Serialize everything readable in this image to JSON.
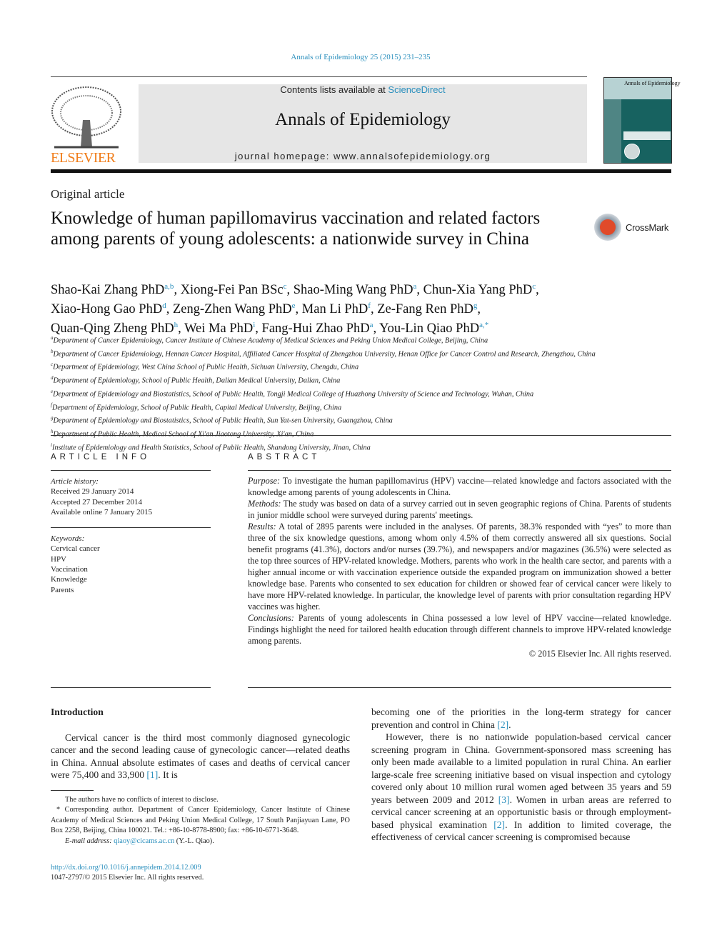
{
  "header": {
    "citation": "Annals of Epidemiology 25 (2015) 231–235",
    "publisher": "ELSEVIER",
    "contents_prefix": "Contents lists available at ",
    "contents_link": "ScienceDirect",
    "journal": "Annals of Epidemiology",
    "homepage": "journal homepage: www.annalsofepidemiology.org",
    "cover_title": "Annals of Epidemiology",
    "colors": {
      "link": "#2a8fbd",
      "publisher": "#f07d1a",
      "cover": "#176260"
    }
  },
  "article_type": "Original article",
  "title": "Knowledge of human papillomavirus vaccination and related factors among parents of young adolescents: a nationwide survey in China",
  "crossmark": "CrossMark",
  "authors": [
    {
      "name": "Shao-Kai Zhang PhD",
      "sup": "a,b"
    },
    {
      "name": "Xiong-Fei Pan BSc",
      "sup": "c"
    },
    {
      "name": "Shao-Ming Wang PhD",
      "sup": "a"
    },
    {
      "name": "Chun-Xia Yang PhD",
      "sup": "c"
    },
    {
      "name": "Xiao-Hong Gao PhD",
      "sup": "d"
    },
    {
      "name": "Zeng-Zhen Wang PhD",
      "sup": "e"
    },
    {
      "name": "Man Li PhD",
      "sup": "f"
    },
    {
      "name": "Ze-Fang Ren PhD",
      "sup": "g"
    },
    {
      "name": "Quan-Qing Zheng PhD",
      "sup": "h"
    },
    {
      "name": "Wei Ma PhD",
      "sup": "i"
    },
    {
      "name": "Fang-Hui Zhao PhD",
      "sup": "a"
    },
    {
      "name": "You-Lin Qiao PhD",
      "sup": "a,*"
    }
  ],
  "affiliations": [
    {
      "key": "a",
      "text": "Department of Cancer Epidemiology, Cancer Institute of Chinese Academy of Medical Sciences and Peking Union Medical College, Beijing, China"
    },
    {
      "key": "b",
      "text": "Department of Cancer Epidemiology, Hennan Cancer Hospital, Affiliated Cancer Hospital of Zhengzhou University, Henan Office for Cancer Control and Research, Zhengzhou, China"
    },
    {
      "key": "c",
      "text": "Department of Epidemiology, West China School of Public Health, Sichuan University, Chengdu, China"
    },
    {
      "key": "d",
      "text": "Department of Epidemiology, School of Public Health, Dalian Medical University, Dalian, China"
    },
    {
      "key": "e",
      "text": "Department of Epidemiology and Biostatistics, School of Public Health, Tongji Medical College of Huazhong University of Science and Technology, Wuhan, China"
    },
    {
      "key": "f",
      "text": "Department of Epidemiology, School of Public Health, Capital Medical University, Beijing, China"
    },
    {
      "key": "g",
      "text": "Department of Epidemiology and Biostatistics, School of Public Health, Sun Yat-sen University, Guangzhou, China"
    },
    {
      "key": "h",
      "text": "Department of Public Health, Medical School of Xi'an Jiaotong University, Xi'an, China"
    },
    {
      "key": "i",
      "text": "Institute of Epidemiology and Health Statistics, School of Public Health, Shandong University, Jinan, China"
    }
  ],
  "article_info": {
    "heading": "ARTICLE INFO",
    "history_label": "Article history:",
    "history": [
      "Received 29 January 2014",
      "Accepted 27 December 2014",
      "Available online 7 January 2015"
    ],
    "keywords_label": "Keywords:",
    "keywords": [
      "Cervical cancer",
      "HPV",
      "Vaccination",
      "Knowledge",
      "Parents"
    ]
  },
  "abstract": {
    "heading": "ABSTRACT",
    "sections": [
      {
        "label": "Purpose:",
        "text": " To investigate the human papillomavirus (HPV) vaccine—related knowledge and factors associated with the knowledge among parents of young adolescents in China."
      },
      {
        "label": "Methods:",
        "text": " The study was based on data of a survey carried out in seven geographic regions of China. Parents of students in junior middle school were surveyed during parents' meetings."
      },
      {
        "label": "Results:",
        "text": " A total of 2895 parents were included in the analyses. Of parents, 38.3% responded with “yes” to more than three of the six knowledge questions, among whom only 4.5% of them correctly answered all six questions. Social benefit programs (41.3%), doctors and/or nurses (39.7%), and newspapers and/or magazines (36.5%) were selected as the top three sources of HPV-related knowledge. Mothers, parents who work in the health care sector, and parents with a higher annual income or with vaccination experience outside the expanded program on immunization showed a better knowledge base. Parents who consented to sex education for children or showed fear of cervical cancer were likely to have more HPV-related knowledge. In particular, the knowledge level of parents with prior consultation regarding HPV vaccines was higher."
      },
      {
        "label": "Conclusions:",
        "text": " Parents of young adolescents in China possessed a low level of HPV vaccine—related knowledge. Findings highlight the need for tailored health education through different channels to improve HPV-related knowledge among parents."
      }
    ],
    "copyright": "© 2015 Elsevier Inc. All rights reserved."
  },
  "body": {
    "intro_heading": "Introduction",
    "col1_p1": [
      "Cervical cancer is the third most commonly diagnosed gynecologic cancer and the second leading cause of gynecologic cancer—related deaths in China. Annual absolute estimates of cases and deaths of cervical cancer were 75,400 and 33,900 ",
      "[1]",
      ". It is"
    ],
    "col2_p1": [
      "becoming one of the priorities in the long-term strategy for cancer prevention and control in China ",
      "[2]",
      "."
    ],
    "col2_p2": [
      "However, there is no nationwide population-based cervical cancer screening program in China. Government-sponsored mass screening has only been made available to a limited population in rural China. An earlier large-scale free screening initiative based on visual inspection and cytology covered only about 10 million rural women aged between 35 years and 59 years between 2009 and 2012 ",
      "[3]",
      ". Women in urban areas are referred to cervical cancer screening at an opportunistic basis or through employment-based physical examination ",
      "[2]",
      ". In addition to limited coverage, the effectiveness of cervical cancer screening is compromised because"
    ]
  },
  "footnotes": {
    "conflict": "The authors have no conflicts of interest to disclose.",
    "corresponding": "* Corresponding author. Department of Cancer Epidemiology, Cancer Institute of Chinese Academy of Medical Sciences and Peking Union Medical College, 17 South Panjiayuan Lane, PO Box 2258, Beijing, China 100021. Tel.: +86-10-8778-8900; fax: +86-10-6771-3648.",
    "email_label": "E-mail address:",
    "email": "qiaoy@cicams.ac.cn",
    "email_suffix": " (Y.-L. Qiao).",
    "doi": "http://dx.doi.org/10.1016/j.annepidem.2014.12.009",
    "issn": "1047-2797/© 2015 Elsevier Inc. All rights reserved."
  }
}
